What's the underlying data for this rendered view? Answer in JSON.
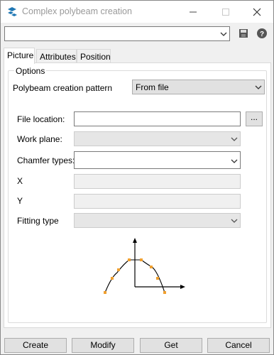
{
  "window": {
    "title": "Complex polybeam creation"
  },
  "preset": {
    "value": ""
  },
  "tabs": [
    {
      "label": "Picture"
    },
    {
      "label": "Attributes"
    },
    {
      "label": "Position"
    }
  ],
  "options": {
    "group_label": "Options",
    "pattern_label": "Polybeam creation pattern",
    "pattern_value": "From file",
    "file_location_label": "File location:",
    "file_location_value": "",
    "browse_label": "...",
    "work_plane_label": "Work plane:",
    "chamfer_types_label": "Chamfer types:",
    "x_label": "X",
    "y_label": "Y",
    "fitting_type_label": "Fitting type"
  },
  "buttons": {
    "create": "Create",
    "modify": "Modify",
    "get": "Get",
    "cancel": "Cancel"
  },
  "colors": {
    "point_marker": "#f0a030"
  }
}
